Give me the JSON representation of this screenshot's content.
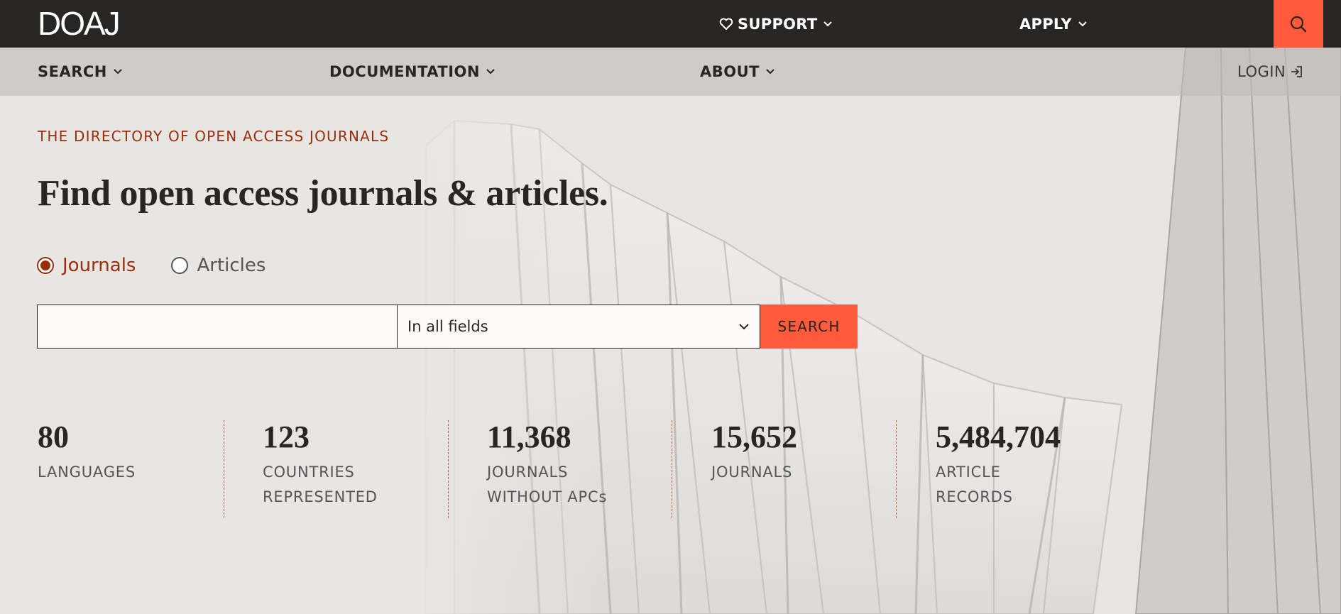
{
  "brand": {
    "logo": "DOAJ"
  },
  "topnav": {
    "support": "SUPPORT",
    "apply": "APPLY"
  },
  "secnav": {
    "search": "SEARCH",
    "documentation": "DOCUMENTATION",
    "about": "ABOUT",
    "login": "LOGIN"
  },
  "hero": {
    "eyebrow": "THE DIRECTORY OF OPEN ACCESS JOURNALS",
    "headline": "Find open access journals & articles.",
    "radio_journals": "Journals",
    "radio_articles": "Articles",
    "selected": "journals",
    "query_value": "",
    "field_select": "In all fields",
    "search_button": "SEARCH"
  },
  "stats": [
    {
      "value": "80",
      "label": "LANGUAGES"
    },
    {
      "value": "123",
      "label": "COUNTRIES\nREPRESENTED"
    },
    {
      "value": "11,368",
      "label": "JOURNALS\nWITHOUT APCs"
    },
    {
      "value": "15,652",
      "label": "JOURNALS"
    },
    {
      "value": "5,484,704",
      "label": "ARTICLE\nRECORDS"
    }
  ],
  "colors": {
    "topbar": "#282624",
    "accent": "#fd5a3b",
    "accent_text": "#982e0a",
    "background": "#e8e6e3"
  },
  "icons": [
    "heart-icon",
    "chevron-down-icon",
    "search-icon",
    "login-icon"
  ]
}
